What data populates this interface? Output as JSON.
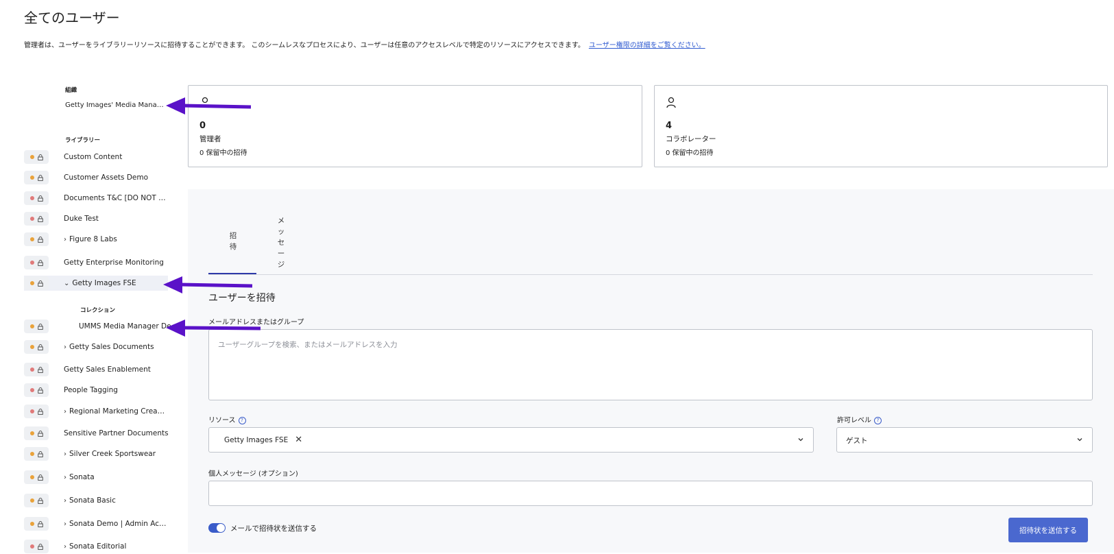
{
  "page": {
    "title": "全てのユーザー",
    "intro": "管理者は、ユーザーをライブラリーリソースに招待することができます。 このシームレスなプロセスにより、ユーザーは任意のアクセスレベルで特定のリソースにアクセスできます。",
    "intro_link": "ユーザー権限の詳細をご覧ください。"
  },
  "sidebar": {
    "org_label": "組織",
    "org_name": "Getty Images' Media Mana…",
    "libraries_label": "ライブラリー",
    "collections_label": "コレクション",
    "libraries": [
      {
        "name": "Custom Content",
        "status": "orange",
        "expandable": false
      },
      {
        "name": "Customer Assets Demo",
        "status": "orange",
        "expandable": false
      },
      {
        "name": "Documents T&C [DO NOT …",
        "status": "red",
        "expandable": false
      },
      {
        "name": "Duke Test",
        "status": "red",
        "expandable": false
      },
      {
        "name": "Figure 8 Labs",
        "status": "orange",
        "expandable": true
      },
      {
        "name": "Getty Enterprise Monitoring",
        "status": "red",
        "expandable": false
      },
      {
        "name": "Getty Images FSE",
        "status": "orange",
        "expandable": true,
        "expanded": true
      },
      {
        "name": "UMMS Media Manager De",
        "status": "orange",
        "collection": true
      },
      {
        "name": "Getty Sales Documents",
        "status": "orange",
        "expandable": true
      },
      {
        "name": "Getty Sales Enablement",
        "status": "red",
        "expandable": false
      },
      {
        "name": "People Tagging",
        "status": "red",
        "expandable": false
      },
      {
        "name": "Regional Marketing Crea…",
        "status": "red",
        "expandable": true
      },
      {
        "name": "Sensitive Partner Documents",
        "status": "orange",
        "expandable": false
      },
      {
        "name": "Silver Creek Sportswear",
        "status": "orange",
        "expandable": true
      },
      {
        "name": "Sonata",
        "status": "orange",
        "expandable": true
      },
      {
        "name": "Sonata Basic",
        "status": "orange",
        "expandable": true
      },
      {
        "name": "Sonata Demo | Admin Ac…",
        "status": "orange",
        "expandable": true
      },
      {
        "name": "Sonata Editorial",
        "status": "red",
        "expandable": true
      }
    ]
  },
  "cards": [
    {
      "count": "0",
      "role": "管理者",
      "pending": "0 保留中の招待",
      "icon": "key-icon"
    },
    {
      "count": "4",
      "role": "コラボレーター",
      "pending": "0 保留中の招待",
      "icon": "user-icon"
    }
  ],
  "tabs": [
    "招\n待",
    "メ\nッ\nセ\nー\nジ"
  ],
  "form": {
    "section_title": "ユーザーを招待",
    "email_label": "メールアドレスまたはグループ",
    "email_placeholder": "ユーザーグループを検索、またはメールアドレスを入力",
    "resource_label": "リソース",
    "resource_chip": "Getty Images FSE",
    "permission_label": "許可レベル",
    "permission_value": "ゲスト",
    "message_label": "個人メッセージ (オプション)",
    "toggle_label": "メールで招待状を送信する",
    "submit_label": "招待状を送信する"
  },
  "colors": {
    "accent": "#4a68cf",
    "status_orange": "#e9a23b",
    "status_red": "#e07a7a",
    "arrow": "#5a12c8"
  }
}
